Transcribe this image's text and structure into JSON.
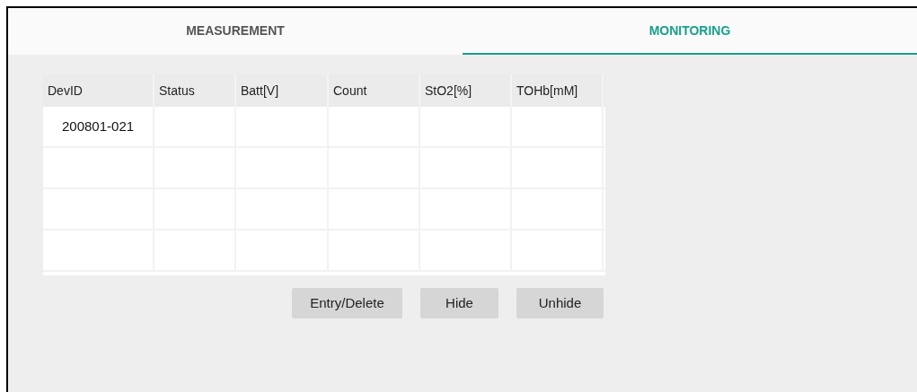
{
  "tabs": [
    {
      "label": "MEASUREMENT",
      "selected": false
    },
    {
      "label": "MONITORING",
      "selected": true
    }
  ],
  "table": {
    "columns": [
      "DevID",
      "Status",
      "Batt[V]",
      "Count",
      "StO2[%]",
      "TOHb[mM]"
    ],
    "rows": [
      {
        "cells": [
          "200801-021"
        ]
      },
      {},
      {},
      {}
    ]
  },
  "buttons": [
    "Entry/Delete",
    "Hide",
    "Unhide"
  ]
}
